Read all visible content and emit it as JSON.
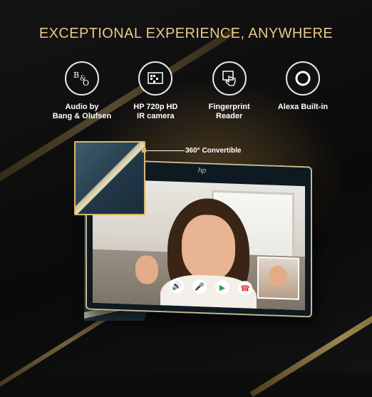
{
  "headline": "EXCEPTIONAL EXPERIENCE, ANYWHERE",
  "features": [
    {
      "icon": "bang-olufsen-logo-icon",
      "line1": "Audio by",
      "line2": "Bang & Olufsen"
    },
    {
      "icon": "camera-chip-icon",
      "line1": "HP 720p HD",
      "line2": "IR camera"
    },
    {
      "icon": "fingerprint-touch-icon",
      "line1": "Fingerprint",
      "line2": "Reader"
    },
    {
      "icon": "alexa-ring-icon",
      "line1": "Alexa Built-in",
      "line2": ""
    }
  ],
  "callout": "360° Convertible",
  "laptop": {
    "brand_logo": "hp"
  },
  "colors": {
    "gold": "#d9b96a",
    "headline": "#e8c98a",
    "laptop_body": "#2f4756"
  }
}
